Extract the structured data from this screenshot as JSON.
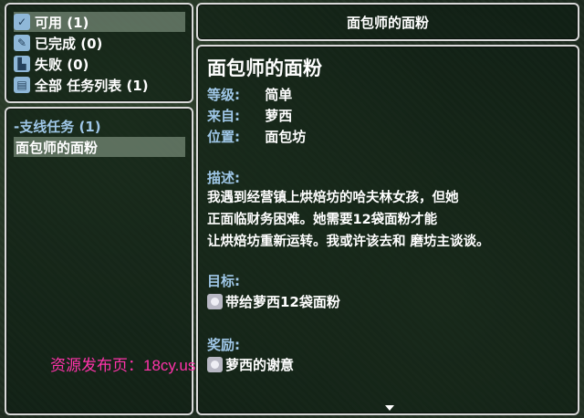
{
  "categories": [
    {
      "label": "可用 (1)",
      "icon": "check-scroll-icon"
    },
    {
      "label": "已完成 (0)",
      "icon": "feather-icon"
    },
    {
      "label": "失败 (0)",
      "icon": "boot-icon"
    },
    {
      "label": "全部 任务列表 (1)",
      "icon": "book-icon"
    }
  ],
  "quest_list": {
    "header": "-支线任务 (1)",
    "items": [
      "面包师的面粉"
    ]
  },
  "detail": {
    "panel_title": "面包师的面粉",
    "name": "面包师的面粉",
    "level_label": "等级:",
    "level": "简单",
    "from_label": "来自:",
    "from": "萝西",
    "location_label": "位置:",
    "location": "面包坊",
    "description_label": "描述:",
    "description": "我遇到经营镇上烘焙坊的哈夫林女孩，但她\n正面临财务困难。她需要12袋面粉才能\n让烘焙坊重新运转。我或许该去和 磨坊主谈谈。",
    "objective_label": "目标:",
    "objective": "带给萝西12袋面粉",
    "reward_label": "奖励:",
    "reward": "萝西的谢意"
  },
  "watermark": "资源发布页：18cy.us",
  "colors": {
    "label_blue": "#9fc7e8",
    "selected_bg": "#8a9a8a",
    "border": "#d9d9d9",
    "watermark": "#ff33aa"
  }
}
